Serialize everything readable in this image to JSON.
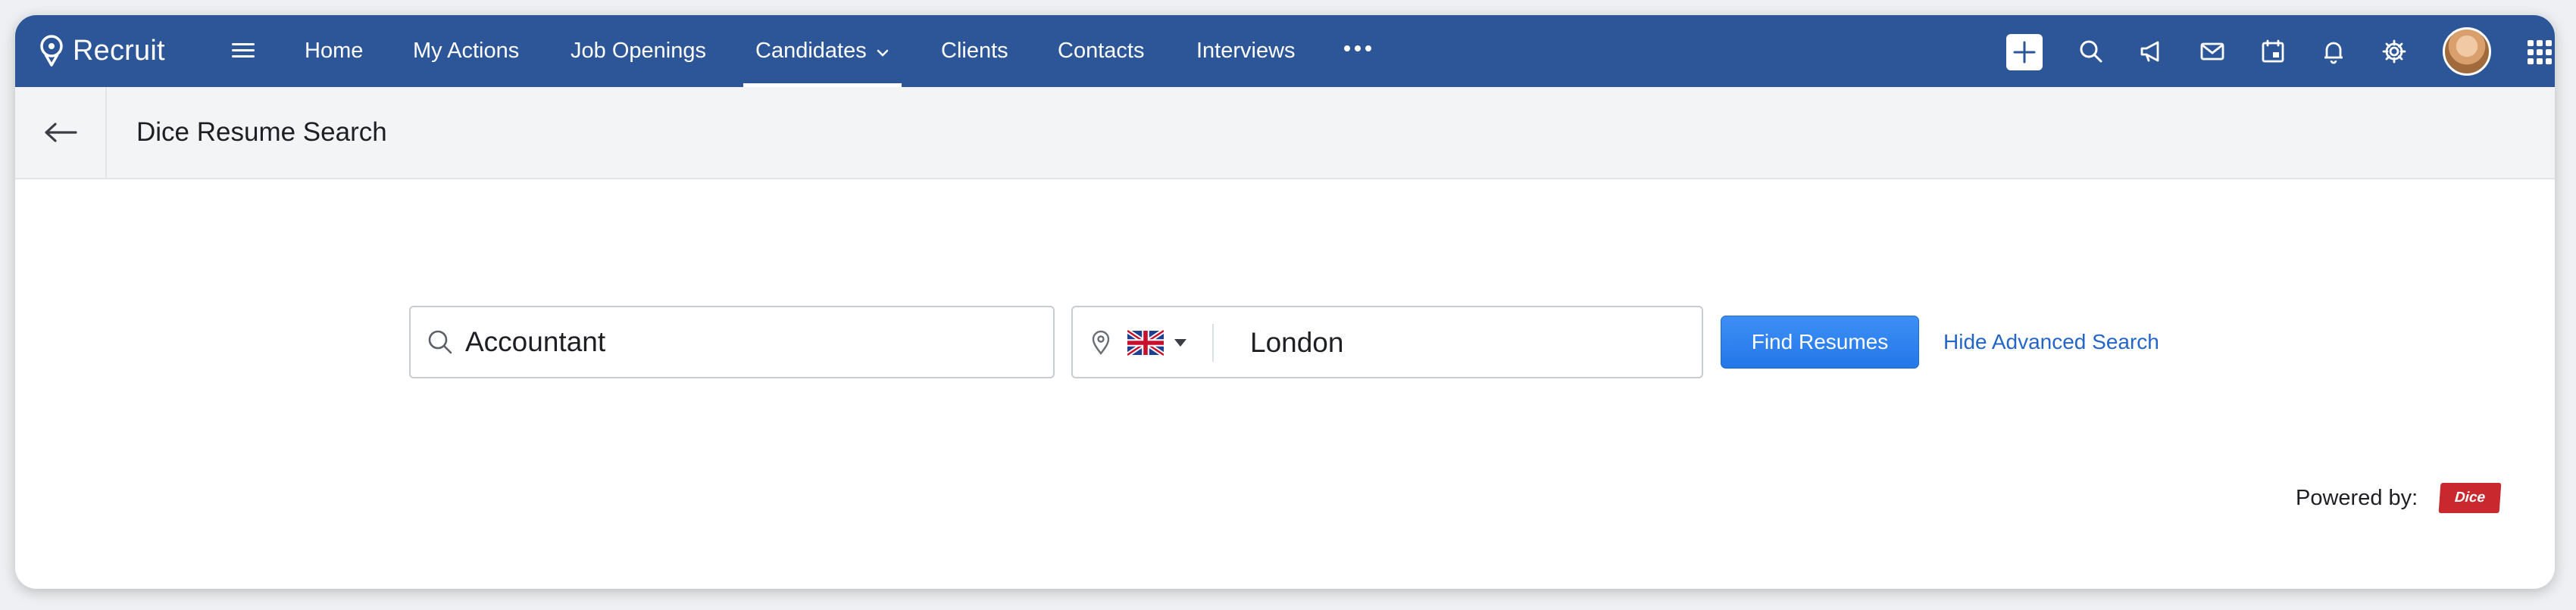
{
  "app": {
    "name": "Recruit"
  },
  "nav": {
    "items": [
      {
        "label": "Home"
      },
      {
        "label": "My Actions"
      },
      {
        "label": "Job Openings"
      },
      {
        "label": "Candidates",
        "active": true,
        "has_dropdown": true
      },
      {
        "label": "Clients"
      },
      {
        "label": "Contacts"
      },
      {
        "label": "Interviews"
      }
    ],
    "more_icon": "more-horizontal-icon",
    "tools": [
      "add-icon",
      "search-icon",
      "megaphone-icon",
      "mail-icon",
      "calendar-icon",
      "bell-icon",
      "gear-icon"
    ],
    "colors": {
      "bar": "#2c5697",
      "text": "#ffffff"
    }
  },
  "page": {
    "title": "Dice Resume Search"
  },
  "search": {
    "keyword_value": "Accountant",
    "country_flag": "United Kingdom flag",
    "location_value": "London",
    "find_button_label": "Find Resumes",
    "advanced_link_label": "Hide Advanced Search",
    "button_color": "#2477e8",
    "link_color": "#2465c8"
  },
  "footer": {
    "powered_by_label": "Powered by:",
    "provider_logo_text": "Dice",
    "logo_color": "#c8282e"
  }
}
